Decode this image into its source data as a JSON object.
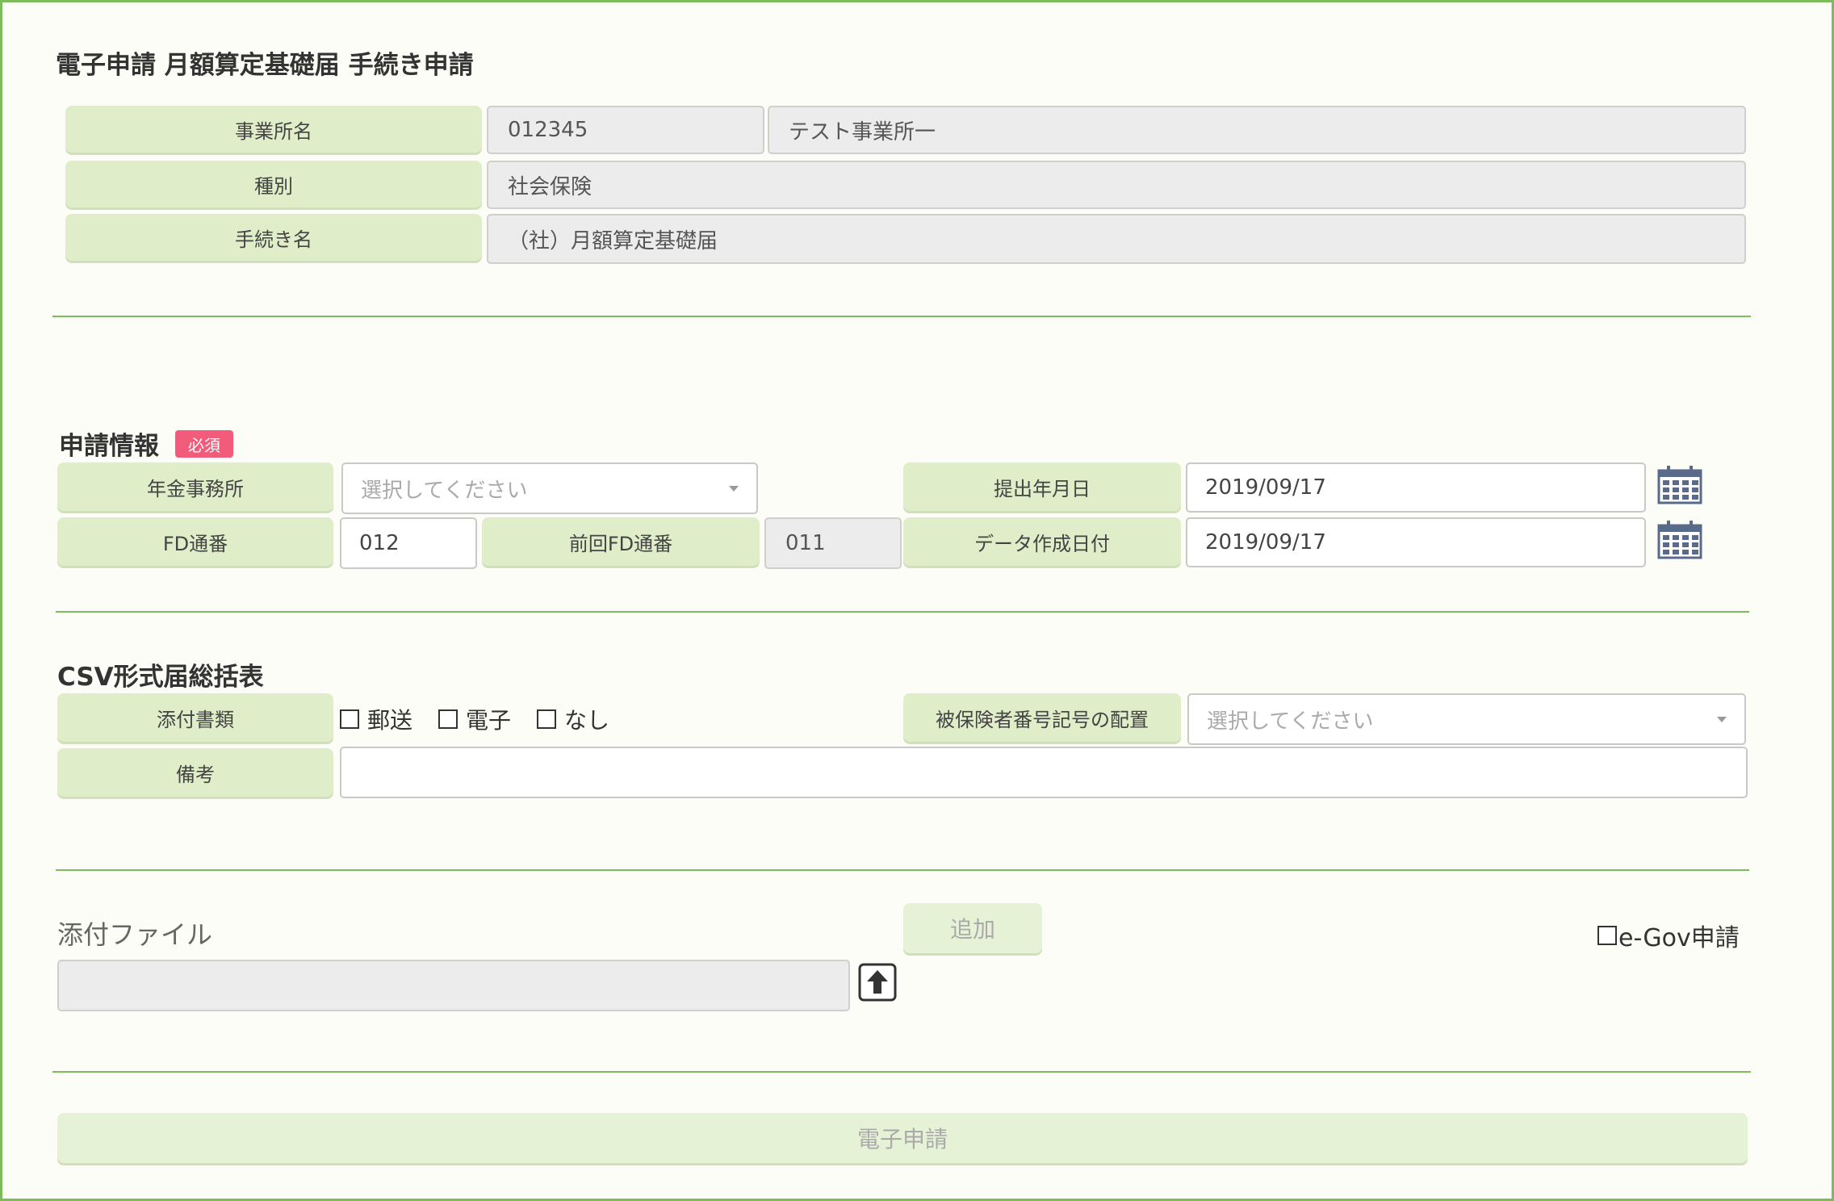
{
  "page": {
    "title": "電子申請 月額算定基礎届 手続き申請"
  },
  "info": {
    "office_label": "事業所名",
    "office_code": "012345",
    "office_name": "テスト事業所一",
    "type_label": "種別",
    "type_value": "社会保険",
    "procedure_label": "手続き名",
    "procedure_value": "（社）月額算定基礎届"
  },
  "application": {
    "heading": "申請情報",
    "required_badge": "必須",
    "pension_office_label": "年金事務所",
    "pension_office_placeholder": "選択してください",
    "submit_date_label": "提出年月日",
    "submit_date_value": "2019/09/17",
    "fd_label": "FD通番",
    "fd_value": "012",
    "prev_fd_label": "前回FD通番",
    "prev_fd_value": "011",
    "data_date_label": "データ作成日付",
    "data_date_value": "2019/09/17"
  },
  "csv": {
    "heading": "CSV形式届総括表",
    "attachment_label": "添付書類",
    "opt_mail": "郵送",
    "opt_electronic": "電子",
    "opt_none": "なし",
    "insured_label": "被保険者番号記号の配置",
    "insured_placeholder": "選択してください",
    "remarks_label": "備考",
    "remarks_value": ""
  },
  "attach": {
    "heading": "添付ファイル",
    "add_label": "追加",
    "egov_label": "e-Gov申請",
    "file_value": ""
  },
  "submit": {
    "label": "電子申請"
  },
  "colors": {
    "accent": "#7dbb5c",
    "label_bg": "#e0edc9",
    "badge": "#f25c7a"
  }
}
